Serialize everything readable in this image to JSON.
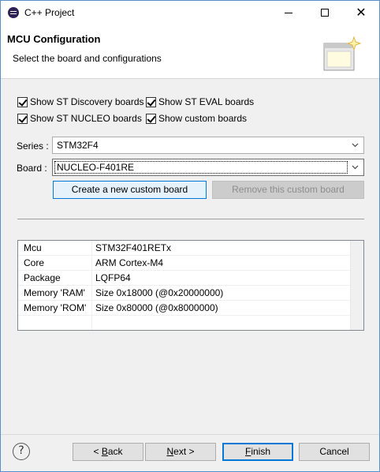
{
  "window": {
    "title": "C++ Project"
  },
  "banner": {
    "title": "MCU Configuration",
    "subtitle": "Select the board and configurations"
  },
  "filters": {
    "discovery": {
      "label": "Show ST Discovery boards",
      "checked": true
    },
    "eval": {
      "label": "Show ST EVAL boards",
      "checked": true
    },
    "nucleo": {
      "label": "Show ST NUCLEO boards",
      "checked": true
    },
    "custom": {
      "label": "Show custom boards",
      "checked": true
    }
  },
  "series": {
    "label": "Series :",
    "value": "STM32F4"
  },
  "board": {
    "label": "Board :",
    "value": "NUCLEO-F401RE"
  },
  "buttons": {
    "create_custom": "Create a new custom board",
    "remove_custom": "Remove this custom board"
  },
  "info_rows": [
    {
      "key": "Mcu",
      "value": "STM32F401RETx"
    },
    {
      "key": "Core",
      "value": "ARM Cortex-M4"
    },
    {
      "key": "Package",
      "value": "LQFP64"
    },
    {
      "key": "Memory 'RAM'",
      "value": "Size 0x18000 (@0x20000000)"
    },
    {
      "key": "Memory 'ROM'",
      "value": "Size 0x80000 (@0x8000000)"
    }
  ],
  "footer": {
    "help": "?",
    "back_prefix": "< ",
    "back_mnemonic": "B",
    "back_rest": "ack",
    "next_mnemonic": "N",
    "next_rest": "ext >",
    "finish_mnemonic": "F",
    "finish_rest": "inish",
    "cancel": "Cancel"
  },
  "icons": {
    "app": "eclipse-icon",
    "minimize": "minimize-icon",
    "maximize": "maximize-icon",
    "close": "close-icon",
    "wizard": "wizard-banner-icon",
    "help": "help-icon",
    "dropdown": "chevron-down-icon"
  }
}
